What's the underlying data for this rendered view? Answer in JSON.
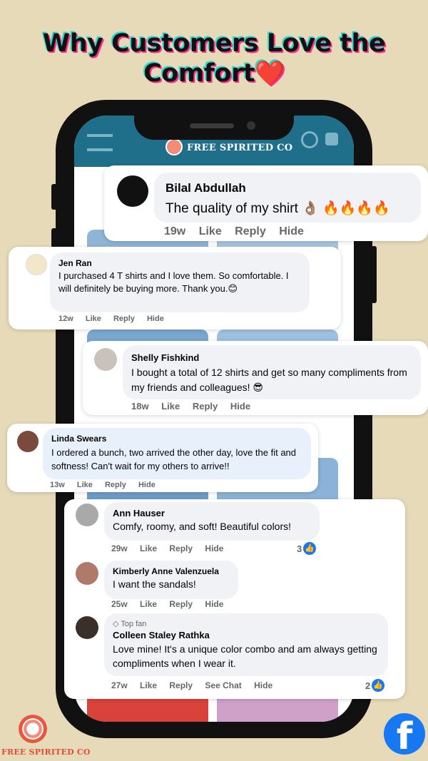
{
  "headline": {
    "line1": "Why Customers Love the",
    "line2": "Comfort",
    "emoji": "❤️"
  },
  "app": {
    "brand": "FREE SPIRITED CO"
  },
  "footer": {
    "brand": "FREE SPIRITED CO",
    "facebook_glyph": "f"
  },
  "icons": {
    "facebook": "facebook-icon",
    "like": "thumbs-up-icon",
    "top_fan": "diamond-badge-icon"
  },
  "colors": {
    "facebook_blue": "#1877f2",
    "appbar": "#1f6f8b",
    "background": "#e6dab8"
  },
  "comments": [
    {
      "name": "Bilal Abdullah",
      "text": "The quality of my shirt 👌🏽 🔥🔥🔥🔥",
      "time": "19w",
      "like": "Like",
      "reply": "Reply",
      "hide": "Hide"
    },
    {
      "name": "Jen Ran",
      "text": "I purchased 4 T shirts and I love them. So comfortable. I will definitely be buying more. Thank you.😊",
      "time": "12w",
      "like": "Like",
      "reply": "Reply",
      "hide": "Hide"
    },
    {
      "name": "Shelly Fishkind",
      "text": "I bought a total of 12 shirts and get so many compliments from my friends and colleagues! 😎",
      "time": "18w",
      "like": "Like",
      "reply": "Reply",
      "hide": "Hide"
    },
    {
      "name": "Linda Swears",
      "text": "I ordered a bunch, two arrived the other day, love the fit and softness! Can't wait for my others to arrive!!",
      "time": "13w",
      "like": "Like",
      "reply": "Reply",
      "hide": "Hide"
    },
    {
      "name": "Ann Hauser",
      "text": "Comfy, roomy, and soft! Beautiful colors!",
      "time": "29w",
      "like": "Like",
      "reply": "Reply",
      "hide": "Hide",
      "reactions": "3"
    },
    {
      "name": "Kimberly Anne Valenzuela",
      "text": "I want the sandals!",
      "time": "25w",
      "like": "Like",
      "reply": "Reply",
      "hide": "Hide"
    },
    {
      "badge": "Top fan",
      "name": "Colleen Staley Rathka",
      "text": "Love mine! It's a unique color combo and am always getting compliments when I wear it.",
      "time": "27w",
      "like": "Like",
      "reply": "Reply",
      "see_chat": "See Chat",
      "hide": "Hide",
      "reactions": "2"
    }
  ]
}
